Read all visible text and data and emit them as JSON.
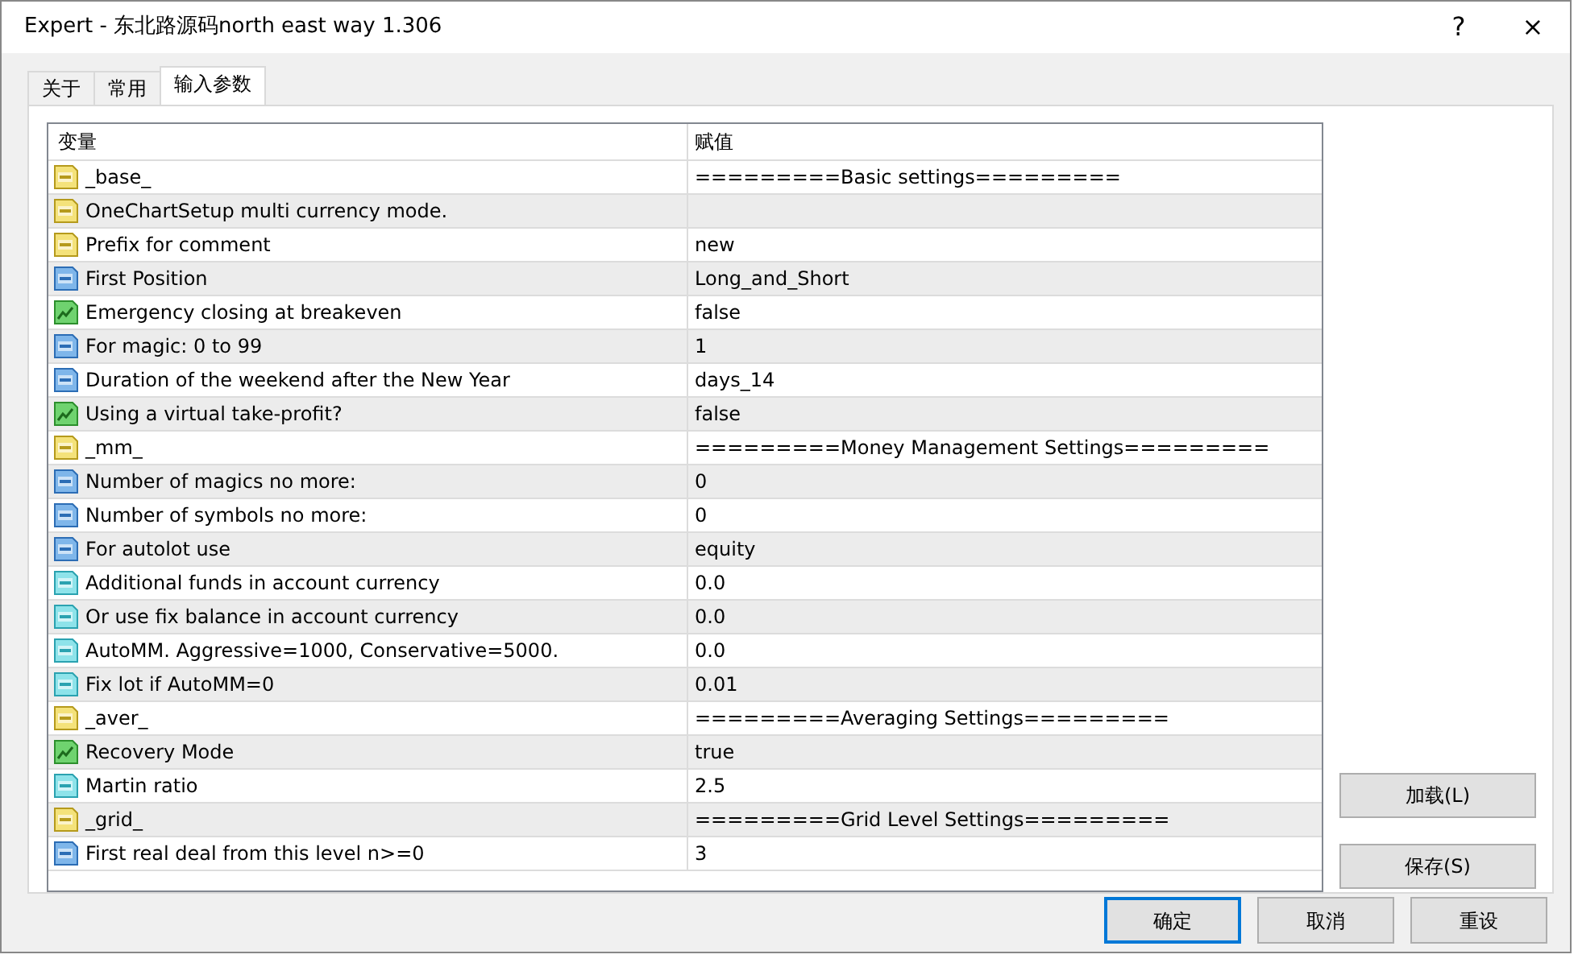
{
  "window": {
    "title": "Expert - 东北路源码north east way 1.306",
    "help": "?",
    "close": "×"
  },
  "tabs": [
    {
      "label": "关于",
      "selected": false
    },
    {
      "label": "常用",
      "selected": false
    },
    {
      "label": "输入参数",
      "selected": true
    }
  ],
  "table": {
    "columns": [
      "变量",
      "赋值"
    ],
    "rows": [
      {
        "kind": "string",
        "name": "_base_",
        "value": "=========Basic settings========="
      },
      {
        "kind": "string",
        "name": "OneChartSetup multi currency mode."
      },
      {
        "kind": "string",
        "name": "Prefix for comment",
        "value": "new"
      },
      {
        "kind": "int",
        "name": "First Position",
        "value": "Long_and_Short"
      },
      {
        "kind": "bool",
        "name": "Emergency closing at breakeven",
        "value": "false"
      },
      {
        "kind": "int",
        "name": "For magic: 0 to 99",
        "value": "1"
      },
      {
        "kind": "int",
        "name": "Duration of the weekend after the New Year",
        "value": "days_14"
      },
      {
        "kind": "bool",
        "name": "Using a virtual take-profit?",
        "value": "false"
      },
      {
        "kind": "string",
        "name": "_mm_",
        "value": "=========Money Management Settings========="
      },
      {
        "kind": "int",
        "name": "Number of magics no more:",
        "value": "0"
      },
      {
        "kind": "int",
        "name": "Number of symbols no more:",
        "value": "0"
      },
      {
        "kind": "int",
        "name": "For autolot use",
        "value": "equity"
      },
      {
        "kind": "double",
        "name": "Additional funds in account currency",
        "value": "0.0"
      },
      {
        "kind": "double",
        "name": "Or use fix balance in account currency",
        "value": "0.0"
      },
      {
        "kind": "double",
        "name": "AutoMM. Aggressive=1000, Conservative=5000.",
        "value": "0.0"
      },
      {
        "kind": "double",
        "name": "Fix lot if AutoMM=0",
        "value": "0.01"
      },
      {
        "kind": "string",
        "name": "_aver_",
        "value": "=========Averaging Settings========="
      },
      {
        "kind": "bool",
        "name": "Recovery Mode",
        "value": "true"
      },
      {
        "kind": "double",
        "name": "Martin ratio",
        "value": "2.5"
      },
      {
        "kind": "string",
        "name": "_grid_",
        "value": "=========Grid Level Settings========="
      },
      {
        "kind": "int",
        "name": "First real deal from this level n>=0",
        "value": "3"
      }
    ]
  },
  "side_buttons": [
    "加载(L)",
    "保存(S)"
  ],
  "buttons": [
    {
      "label": "确定",
      "default": true
    },
    {
      "label": "取消",
      "default": false
    },
    {
      "label": "重设",
      "default": false
    }
  ]
}
